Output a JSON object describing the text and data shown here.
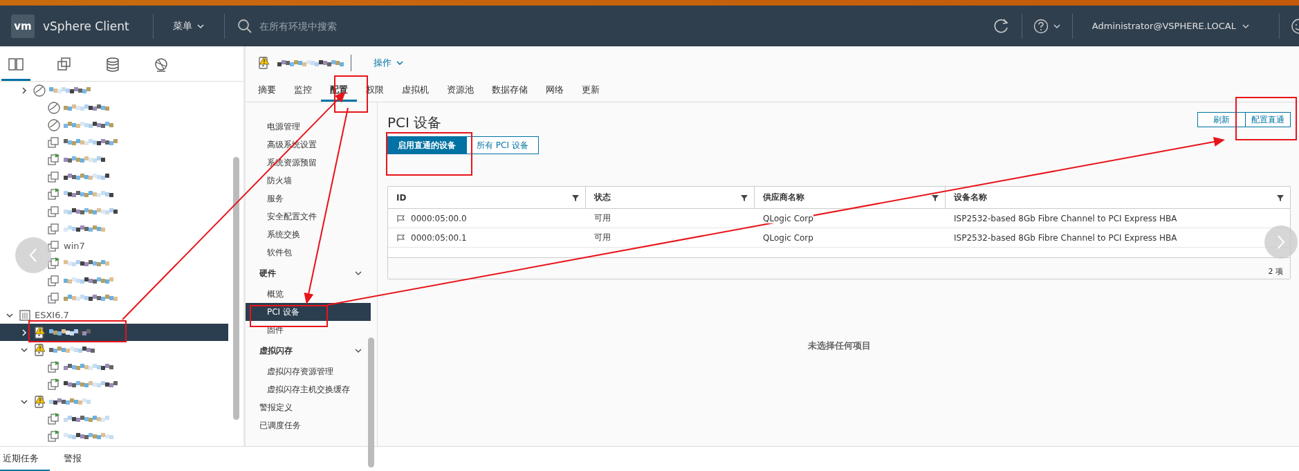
{
  "header": {
    "logo": "vm",
    "title": "vSphere Client",
    "menu": "菜单",
    "search": {
      "placeholder": "在所有环境中搜索"
    },
    "user": "Administrator@VSPHERE.LOCAL"
  },
  "navigator": {
    "tabs": [
      {
        "selected": true
      },
      {
        "selected": false
      },
      {
        "selected": false
      },
      {
        "selected": false
      }
    ],
    "continued": [
      {
        "kind": "pool",
        "expanded": false
      },
      {
        "kind": "pool"
      },
      {
        "kind": "pool"
      },
      {
        "kind": "vm",
        "powered_on": false
      },
      {
        "kind": "vm",
        "powered_on": true
      },
      {
        "kind": "vm",
        "powered_on": false
      },
      {
        "kind": "vm",
        "powered_on": true
      },
      {
        "kind": "vm",
        "powered_on": false
      },
      {
        "kind": "vm",
        "powered_on": false
      },
      {
        "kind": "vm",
        "powered_on": false,
        "label": "win7"
      },
      {
        "kind": "vm",
        "powered_on": true
      },
      {
        "kind": "vm",
        "powered_on": false
      },
      {
        "kind": "vm",
        "powered_on": false
      }
    ],
    "tree": [
      {
        "kind": "cluster",
        "label": "ESXI6.7",
        "expanded": true,
        "children": [
          {
            "kind": "host",
            "warning": true,
            "expanded": false,
            "selected": true
          },
          {
            "kind": "host",
            "warning": true,
            "expanded": true,
            "selected": false,
            "children": [
              {
                "kind": "vm",
                "powered_on": true
              },
              {
                "kind": "vm",
                "powered_on": true
              }
            ]
          },
          {
            "kind": "host",
            "warning": true,
            "expanded": true,
            "selected": false,
            "children": [
              {
                "kind": "vm",
                "powered_on": true
              },
              {
                "kind": "vm",
                "powered_on": true
              }
            ]
          }
        ]
      }
    ]
  },
  "object": {
    "warning": true,
    "actions": "操作",
    "tabs": [
      {
        "label": "摘要",
        "selected": false
      },
      {
        "label": "监控",
        "selected": false
      },
      {
        "label": "配置",
        "selected": true
      },
      {
        "label": "权限",
        "selected": false
      },
      {
        "label": "虚拟机",
        "selected": false
      },
      {
        "label": "资源池",
        "selected": false
      },
      {
        "label": "数据存储",
        "selected": false
      },
      {
        "label": "网络",
        "selected": false
      },
      {
        "label": "更新",
        "selected": false
      }
    ]
  },
  "config_nav": {
    "continued": [
      {
        "label": "电源管理",
        "selected": false
      },
      {
        "label": "高级系统设置",
        "selected": false
      },
      {
        "label": "系统资源预留",
        "selected": false
      },
      {
        "label": "防火墙",
        "selected": false
      },
      {
        "label": "服务",
        "selected": false
      },
      {
        "label": "安全配置文件",
        "selected": false
      },
      {
        "label": "系统交换",
        "selected": false
      },
      {
        "label": "软件包",
        "selected": false
      }
    ],
    "groups": [
      {
        "label": "硬件",
        "expanded": true,
        "children": [
          {
            "label": "概览",
            "selected": false
          },
          {
            "label": "PCI 设备",
            "selected": true
          },
          {
            "label": "固件",
            "selected": false
          }
        ]
      },
      {
        "label": "虚拟闪存",
        "expanded": true,
        "children": [
          {
            "label": "虚拟闪存资源管理",
            "selected": false
          },
          {
            "label": "虚拟闪存主机交换缓存",
            "selected": false
          }
        ]
      }
    ],
    "items": [
      {
        "label": "警报定义",
        "selected": false
      },
      {
        "label": "已调度任务",
        "selected": false
      }
    ]
  },
  "panel": {
    "title": "PCI 设备",
    "buttons": [
      "刷新",
      "配置直通"
    ],
    "segments": [
      {
        "label": "启用直通的设备",
        "selected": true
      },
      {
        "label": "所有 PCI 设备",
        "selected": false
      }
    ],
    "table": {
      "columns": [
        "ID",
        "状态",
        "供应商名称",
        "设备名称"
      ],
      "rows": [
        [
          "0000:05:00.0",
          "可用",
          "QLogic Corp",
          "ISP2532-based 8Gb Fibre Channel to PCI Express HBA"
        ],
        [
          "0000:05:00.1",
          "可用",
          "QLogic Corp",
          "ISP2532-based 8Gb Fibre Channel to PCI Express HBA"
        ]
      ],
      "footer": "2 项"
    },
    "empty": "未选择任何项目"
  },
  "bottom_tabs": [
    {
      "label": "近期任务",
      "selected": true
    },
    {
      "label": "警报",
      "selected": false
    }
  ],
  "annotations": [
    {
      "kind": "box"
    },
    {
      "kind": "box"
    },
    {
      "kind": "box"
    },
    {
      "kind": "box"
    },
    {
      "kind": "box"
    },
    {
      "kind": "arrow"
    },
    {
      "kind": "arrow"
    },
    {
      "kind": "arrow"
    }
  ]
}
